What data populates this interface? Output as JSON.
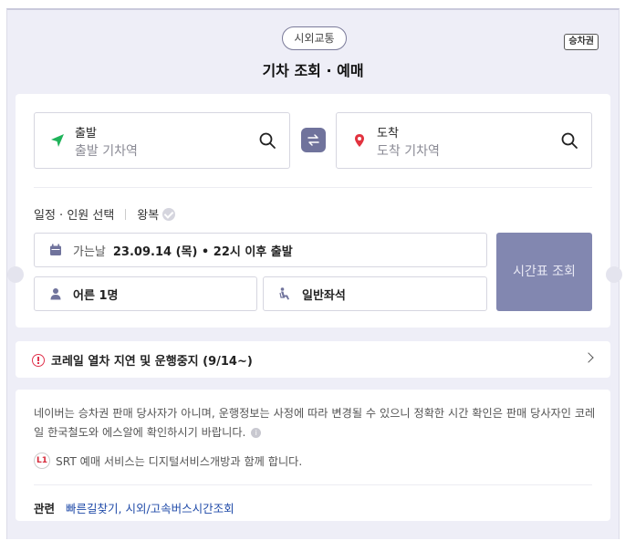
{
  "header": {
    "category_pill": "시외교통",
    "ticket_badge": "승차권",
    "title": "기차 조회 · 예매"
  },
  "search": {
    "departure": {
      "label": "출발",
      "placeholder": "출발 기차역"
    },
    "arrival": {
      "label": "도착",
      "placeholder": "도착 기차역"
    },
    "schedule_label": "일정 · 인원 선택",
    "round_trip_label": "왕복",
    "date_label": "가는날",
    "date_value": "23.09.14 (목) • 22시 이후 출발",
    "passengers": "어른 1명",
    "seat_type": "일반좌석",
    "submit_label": "시간표 조회"
  },
  "notice": {
    "text": "코레일 열차 지연 및 운행중지 (9/14~)"
  },
  "info": {
    "disclaimer": "네이버는 승차권 판매 당사자가 아니며, 운행정보는 사정에 따라 변경될 수 있으니 정확한 시간 확인은 판매 당사자인 코레일 한국철도와 에스알에 확인하시기 바랍니다.",
    "srt_logo": "L1",
    "srt_text": "SRT 예매 서비스는 디지털서비스개방과 함께 합니다.",
    "related_label": "관련",
    "related_links": "빠른길찾기, 시외/고속버스시간조회"
  },
  "colors": {
    "accent": "#70739c",
    "submit_bg": "#8287b0",
    "departure_icon": "#1fb35a",
    "arrival_icon": "#e2333f",
    "warning": "#e0334d",
    "link": "#1f4aa8"
  }
}
